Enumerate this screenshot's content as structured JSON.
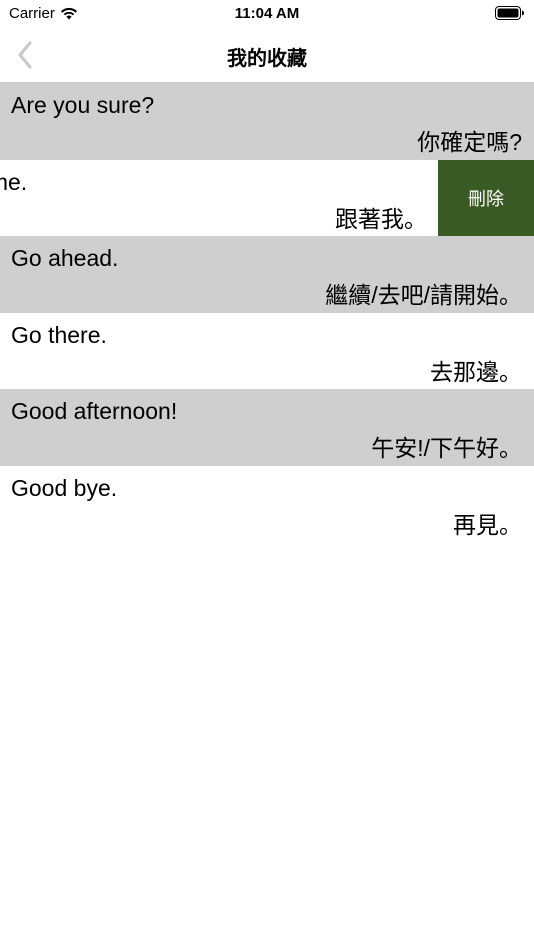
{
  "status_bar": {
    "carrier": "Carrier",
    "time": "11:04 AM"
  },
  "nav": {
    "title": "我的收藏"
  },
  "rows": [
    {
      "en": "Are you sure?",
      "zh": "你確定嗎?"
    },
    {
      "en": "Follow me.",
      "zh": "跟著我。",
      "delete_label": "刪除"
    },
    {
      "en": "Go ahead.",
      "zh": "繼續/去吧/請開始。"
    },
    {
      "en": "Go there.",
      "zh": "去那邊。"
    },
    {
      "en": "Good afternoon!",
      "zh": "午安!/下午好。"
    },
    {
      "en": "Good bye.",
      "zh": "再見。"
    }
  ],
  "colors": {
    "row_gray": "#cfcfcf",
    "delete_bg": "#3a5a23",
    "back_chevron": "#c7c7cc"
  }
}
